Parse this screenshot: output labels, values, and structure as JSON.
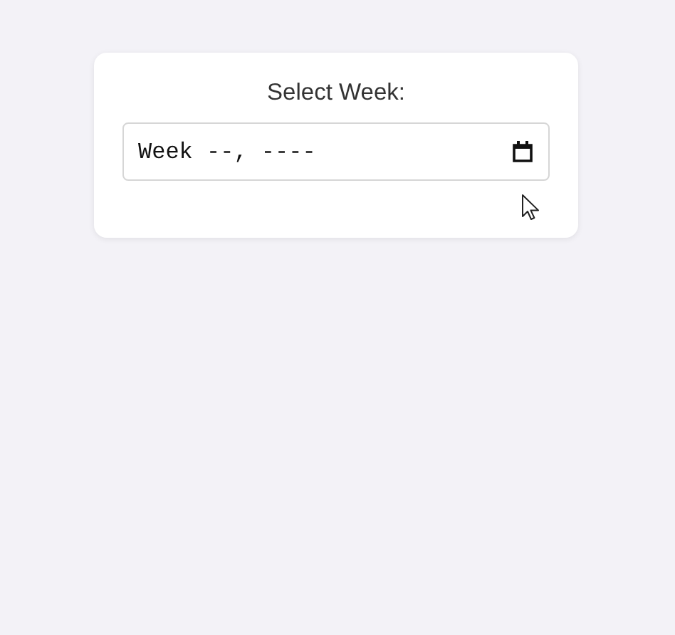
{
  "card": {
    "label": "Select Week:",
    "week_field": {
      "text": "Week --, ----"
    }
  }
}
